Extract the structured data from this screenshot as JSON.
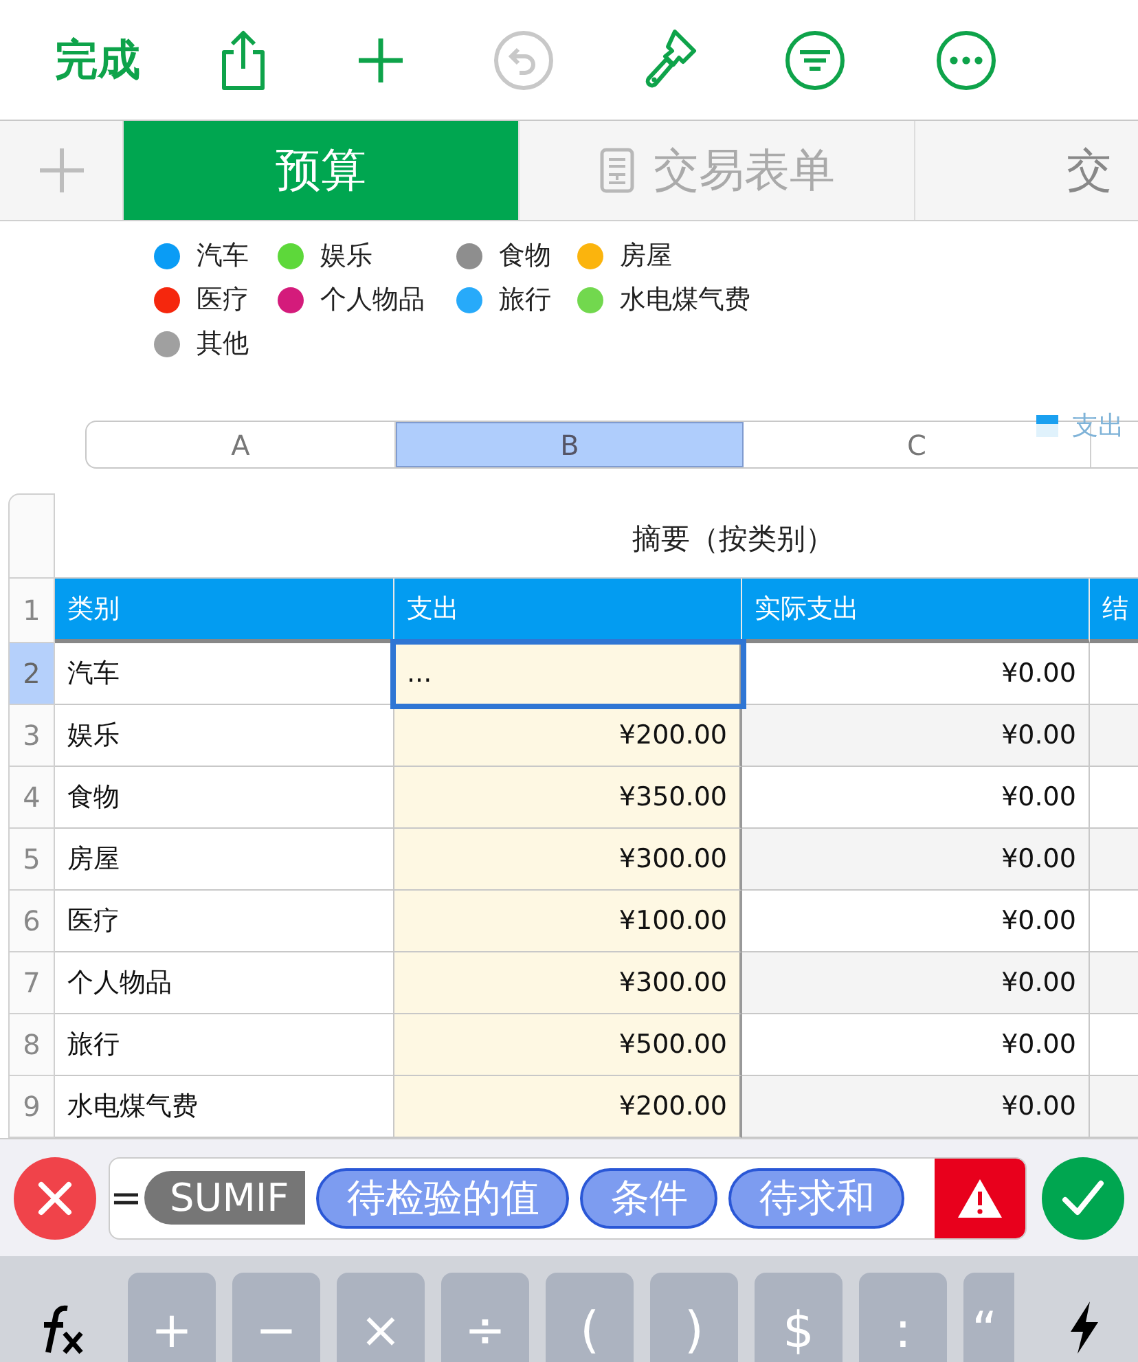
{
  "toolbar": {
    "done_label": "完成",
    "undo_disabled": true
  },
  "tabs": [
    {
      "label": "预算",
      "selected": true,
      "kind": "plain"
    },
    {
      "label": "交易表单",
      "selected": false,
      "kind": "form"
    },
    {
      "label": "交",
      "selected": false,
      "kind": "plain"
    }
  ],
  "legend": [
    {
      "label": "汽车",
      "color": "#0a9cf5"
    },
    {
      "label": "娱乐",
      "color": "#5dd83a"
    },
    {
      "label": "食物",
      "color": "#8e8e8e"
    },
    {
      "label": "房屋",
      "color": "#fbb40d"
    },
    {
      "label": "医疗",
      "color": "#f5270d"
    },
    {
      "label": "个人物品",
      "color": "#d41b7b"
    },
    {
      "label": "旅行",
      "color": "#27aafa"
    },
    {
      "label": "水电煤气费",
      "color": "#72d84e"
    },
    {
      "label": "其他",
      "color": "#a0a0a0"
    }
  ],
  "chart_legend": {
    "label": "支出"
  },
  "column_letters": [
    {
      "label": "A",
      "selected": false
    },
    {
      "label": "B",
      "selected": true
    },
    {
      "label": "C",
      "selected": false
    }
  ],
  "table": {
    "title": "摘要（按类别）",
    "header_num": "1",
    "columns": [
      "类别",
      "支出",
      "实际支出",
      "结"
    ],
    "rows": [
      {
        "num": "2",
        "cells": [
          "汽车",
          "...",
          "¥0.00",
          ""
        ],
        "editing": true
      },
      {
        "num": "3",
        "cells": [
          "娱乐",
          "¥200.00",
          "¥0.00",
          ""
        ],
        "editing": false
      },
      {
        "num": "4",
        "cells": [
          "食物",
          "¥350.00",
          "¥0.00",
          ""
        ],
        "editing": false
      },
      {
        "num": "5",
        "cells": [
          "房屋",
          "¥300.00",
          "¥0.00",
          ""
        ],
        "editing": false
      },
      {
        "num": "6",
        "cells": [
          "医疗",
          "¥100.00",
          "¥0.00",
          ""
        ],
        "editing": false
      },
      {
        "num": "7",
        "cells": [
          "个人物品",
          "¥300.00",
          "¥0.00",
          ""
        ],
        "editing": false
      },
      {
        "num": "8",
        "cells": [
          "旅行",
          "¥500.00",
          "¥0.00",
          ""
        ],
        "editing": false
      },
      {
        "num": "9",
        "cells": [
          "水电煤气费",
          "¥200.00",
          "¥0.00",
          ""
        ],
        "editing": false
      }
    ]
  },
  "formula": {
    "equals": "=",
    "function": "SUMIF",
    "arguments": [
      "待检验的值",
      "条件",
      "待求和"
    ],
    "error": true
  },
  "keys": [
    "+",
    "−",
    "×",
    "÷",
    "(",
    ")",
    "$",
    ":",
    "“"
  ]
}
